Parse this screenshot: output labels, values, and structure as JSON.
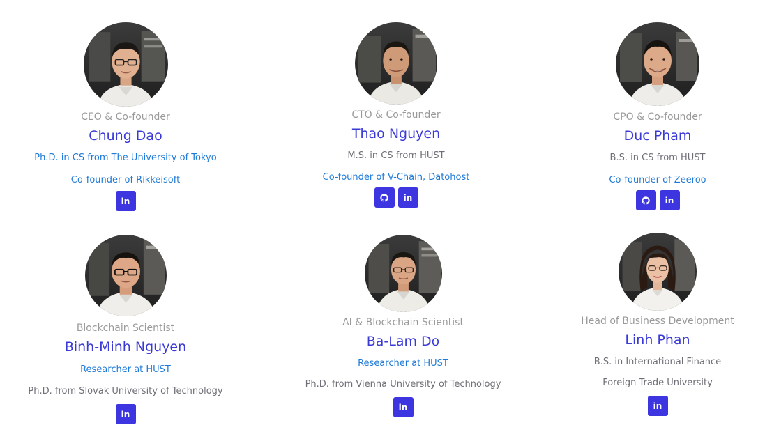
{
  "colors": {
    "role_text": "#9a9a9a",
    "name_text": "#3a3ad6",
    "accent_link": "#1e7ad8",
    "muted_text": "#6f6f78",
    "button_bg": "#3d35df"
  },
  "team": [
    {
      "role": "CEO & Co-founder",
      "name": "Chung Dao",
      "line1": "Ph.D. in CS from The University of Tokyo",
      "line2": "Co-founder of Rikkeisoft",
      "socials": [
        "linkedin-icon"
      ],
      "linkedin_label": "in"
    },
    {
      "role": "CTO & Co-founder",
      "name": "Thao Nguyen",
      "line1": "M.S. in CS from HUST",
      "line2": "Co-founder of V-Chain, Datohost",
      "socials": [
        "github-icon",
        "linkedin-icon"
      ],
      "linkedin_label": "in"
    },
    {
      "role": "CPO & Co-founder",
      "name": "Duc Pham",
      "line1": "B.S. in CS from HUST",
      "line2": "Co-founder of Zeeroo",
      "socials": [
        "github-icon",
        "linkedin-icon"
      ],
      "linkedin_label": "in"
    },
    {
      "role": "Blockchain Scientist",
      "name": "Binh-Minh Nguyen",
      "line1": "Researcher at HUST",
      "line2": "Ph.D. from Slovak University of Technology",
      "socials": [
        "linkedin-icon"
      ],
      "linkedin_label": "in"
    },
    {
      "role": "AI & Blockchain Scientist",
      "name": "Ba-Lam Do",
      "line1": "Researcher at HUST",
      "line2": "Ph.D. from Vienna University of Technology",
      "socials": [
        "linkedin-icon"
      ],
      "linkedin_label": "in"
    },
    {
      "role": "Head of Business Development",
      "name": "Linh Phan",
      "line1": "B.S. in International Finance",
      "line2": "Foreign Trade University",
      "socials": [
        "linkedin-icon"
      ],
      "linkedin_label": "in"
    }
  ]
}
